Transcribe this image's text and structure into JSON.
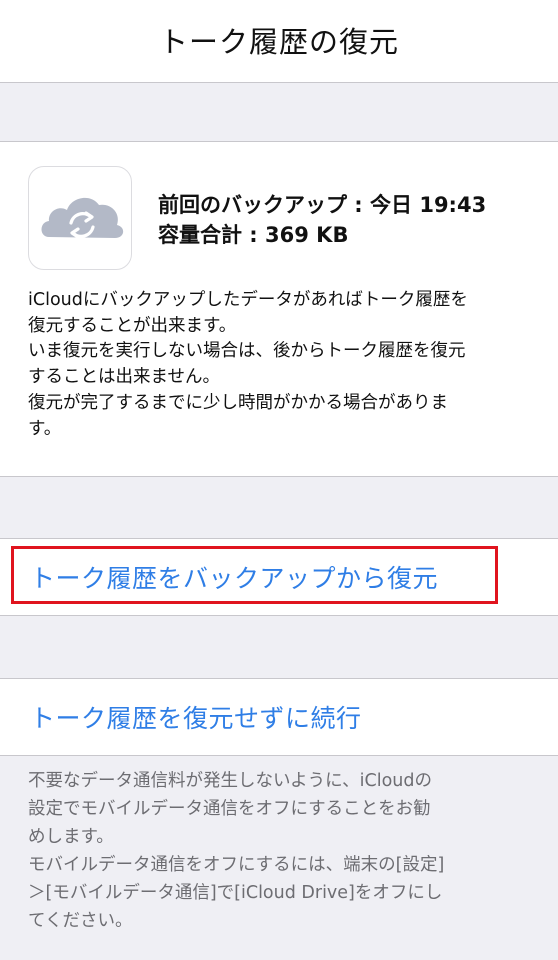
{
  "nav": {
    "title": "トーク履歴の復元"
  },
  "backup": {
    "icon": "icloud-sync-icon",
    "last_backup": "前回のバックアップ : 今日 19:43",
    "total_size": "容量合計 : 369 KB",
    "description_lines": [
      "iCloudにバックアップしたデータがあればトーク履歴を",
      "復元することが出来ます。",
      "いま復元を実行しない場合は、後からトーク履歴を復元",
      "することは出来ません。",
      "復元が完了するまでに少し時間がかかる場合がありま",
      "す。"
    ]
  },
  "actions": {
    "restore_label": "トーク履歴をバックアップから復元",
    "skip_label": "トーク履歴を復元せずに続行"
  },
  "footer_note_lines": [
    "不要なデータ通信料が発生しないように、iCloudの",
    "設定でモバイルデータ通信をオフにすることをお勧",
    "めします。",
    "モバイルデータ通信をオフにするには、端末の[設定]",
    "＞[モバイルデータ通信]で[iCloud Drive]をオフにし",
    "てください。"
  ],
  "colors": {
    "link": "#2f7ee6",
    "highlight_border": "#e0141e",
    "grouped_background": "#efeff4",
    "icon_fill": "#b3b9c7"
  }
}
